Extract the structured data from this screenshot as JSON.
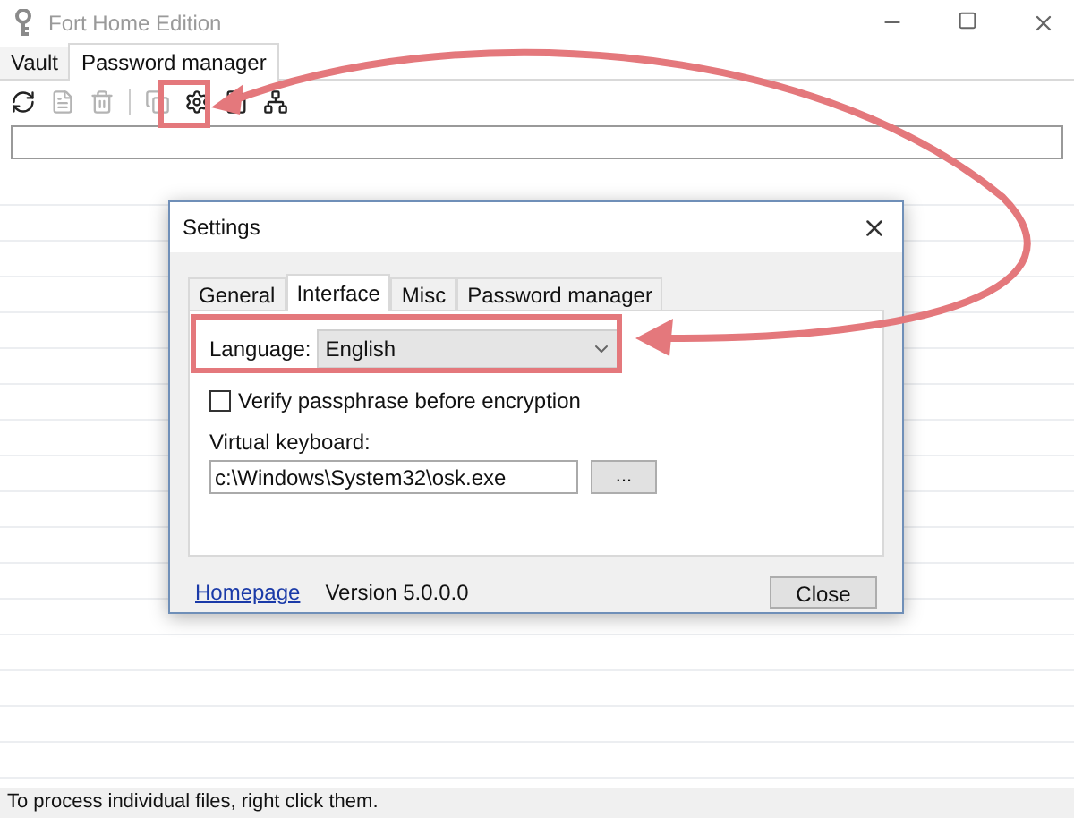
{
  "window": {
    "title": "Fort Home Edition"
  },
  "tabs": [
    {
      "label": "Vault",
      "selected": false
    },
    {
      "label": "Password manager",
      "selected": true
    }
  ],
  "toolbar": [
    {
      "disabled": false
    },
    {
      "disabled": true
    },
    {
      "disabled": true
    },
    {
      "disabled": true
    },
    {
      "disabled": false
    },
    {
      "disabled": false
    },
    {
      "disabled": false
    }
  ],
  "dialog": {
    "title": "Settings",
    "tabs": [
      {
        "label": "General",
        "selected": false
      },
      {
        "label": "Interface",
        "selected": true
      },
      {
        "label": "Misc",
        "selected": false
      },
      {
        "label": "Password manager",
        "selected": false
      }
    ],
    "language": {
      "label": "Language:",
      "value": "English"
    },
    "verify": {
      "label": "Verify passphrase before encryption",
      "checked": false
    },
    "keyboard": {
      "label": "Virtual keyboard:",
      "value": "c:\\Windows\\System32\\osk.exe",
      "browse": "..."
    },
    "homepage": "Homepage",
    "version": "Version 5.0.0.0",
    "close": "Close"
  },
  "status_bar": "To process individual files, right click them."
}
